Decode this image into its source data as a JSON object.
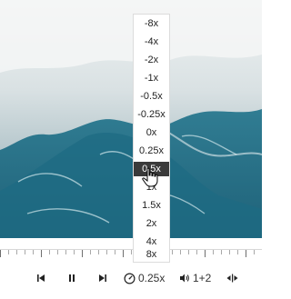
{
  "speed_menu": {
    "options": [
      "-8x",
      "-4x",
      "-2x",
      "-1x",
      "-0.5x",
      "-0.25x",
      "0x",
      "0.25x",
      "0.5x",
      "1x",
      "1.5x",
      "2x",
      "4x",
      "8x"
    ],
    "selected": "0.5x"
  },
  "controls": {
    "speed_value": "0.25x",
    "audio_value": "1+2",
    "icons": [
      "skip-previous-icon",
      "pause-icon",
      "skip-next-icon",
      "speed-gauge-icon",
      "audio-volume-icon",
      "expand-horizontal-icon"
    ]
  },
  "colors": {
    "selected_bg": "#3a3a3a",
    "video_water": "#2d7d93",
    "foam": "#e7eced"
  }
}
